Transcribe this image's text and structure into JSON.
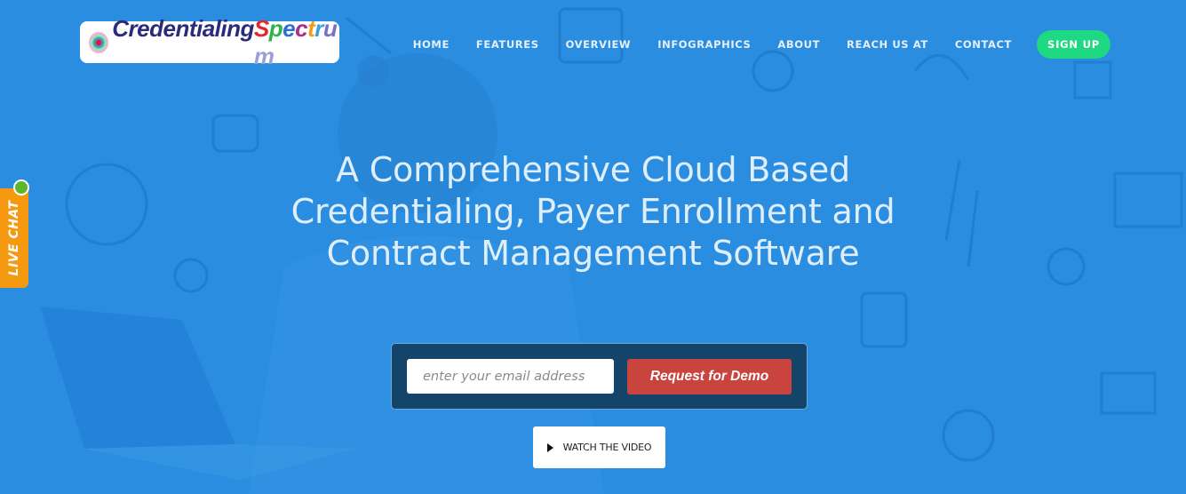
{
  "brand": {
    "name_part1": "Credentialing",
    "name_part2_letters": [
      {
        "ch": "S",
        "color": "#e02a2a"
      },
      {
        "ch": "p",
        "color": "#2db34a"
      },
      {
        "ch": "e",
        "color": "#2a6fd6"
      },
      {
        "ch": "c",
        "color": "#b02d8e"
      },
      {
        "ch": "t",
        "color": "#f29a1c"
      },
      {
        "ch": "r",
        "color": "#3aa0e0"
      },
      {
        "ch": "u",
        "color": "#7a6fc4"
      },
      {
        "ch": "m",
        "color": "#9aa0d8"
      }
    ]
  },
  "nav": {
    "items": [
      {
        "label": "HOME"
      },
      {
        "label": "FEATURES"
      },
      {
        "label": "OVERVIEW"
      },
      {
        "label": "INFOGRAPHICS"
      },
      {
        "label": "ABOUT"
      },
      {
        "label": "REACH US AT"
      },
      {
        "label": "CONTACT"
      }
    ],
    "signup_label": "SIGN UP"
  },
  "hero": {
    "headline_lines": [
      "A Comprehensive Cloud Based",
      "Credentialing, Payer Enrollment and",
      "Contract Management Software"
    ],
    "email_placeholder": "enter your email address",
    "email_value": "",
    "demo_button_label": "Request for Demo",
    "video_button_label": "WATCH THE VIDEO",
    "video_icon": "play-icon"
  },
  "live_chat": {
    "label": "LIVE CHAT",
    "status_icon": "online-status-dot",
    "status_color": "#5cb82a"
  },
  "colors": {
    "background": "#2a8de0",
    "signup": "#1ed882",
    "demo_button": "#c9443e",
    "form_box": "#15446b",
    "live_chat": "#f59a10"
  }
}
